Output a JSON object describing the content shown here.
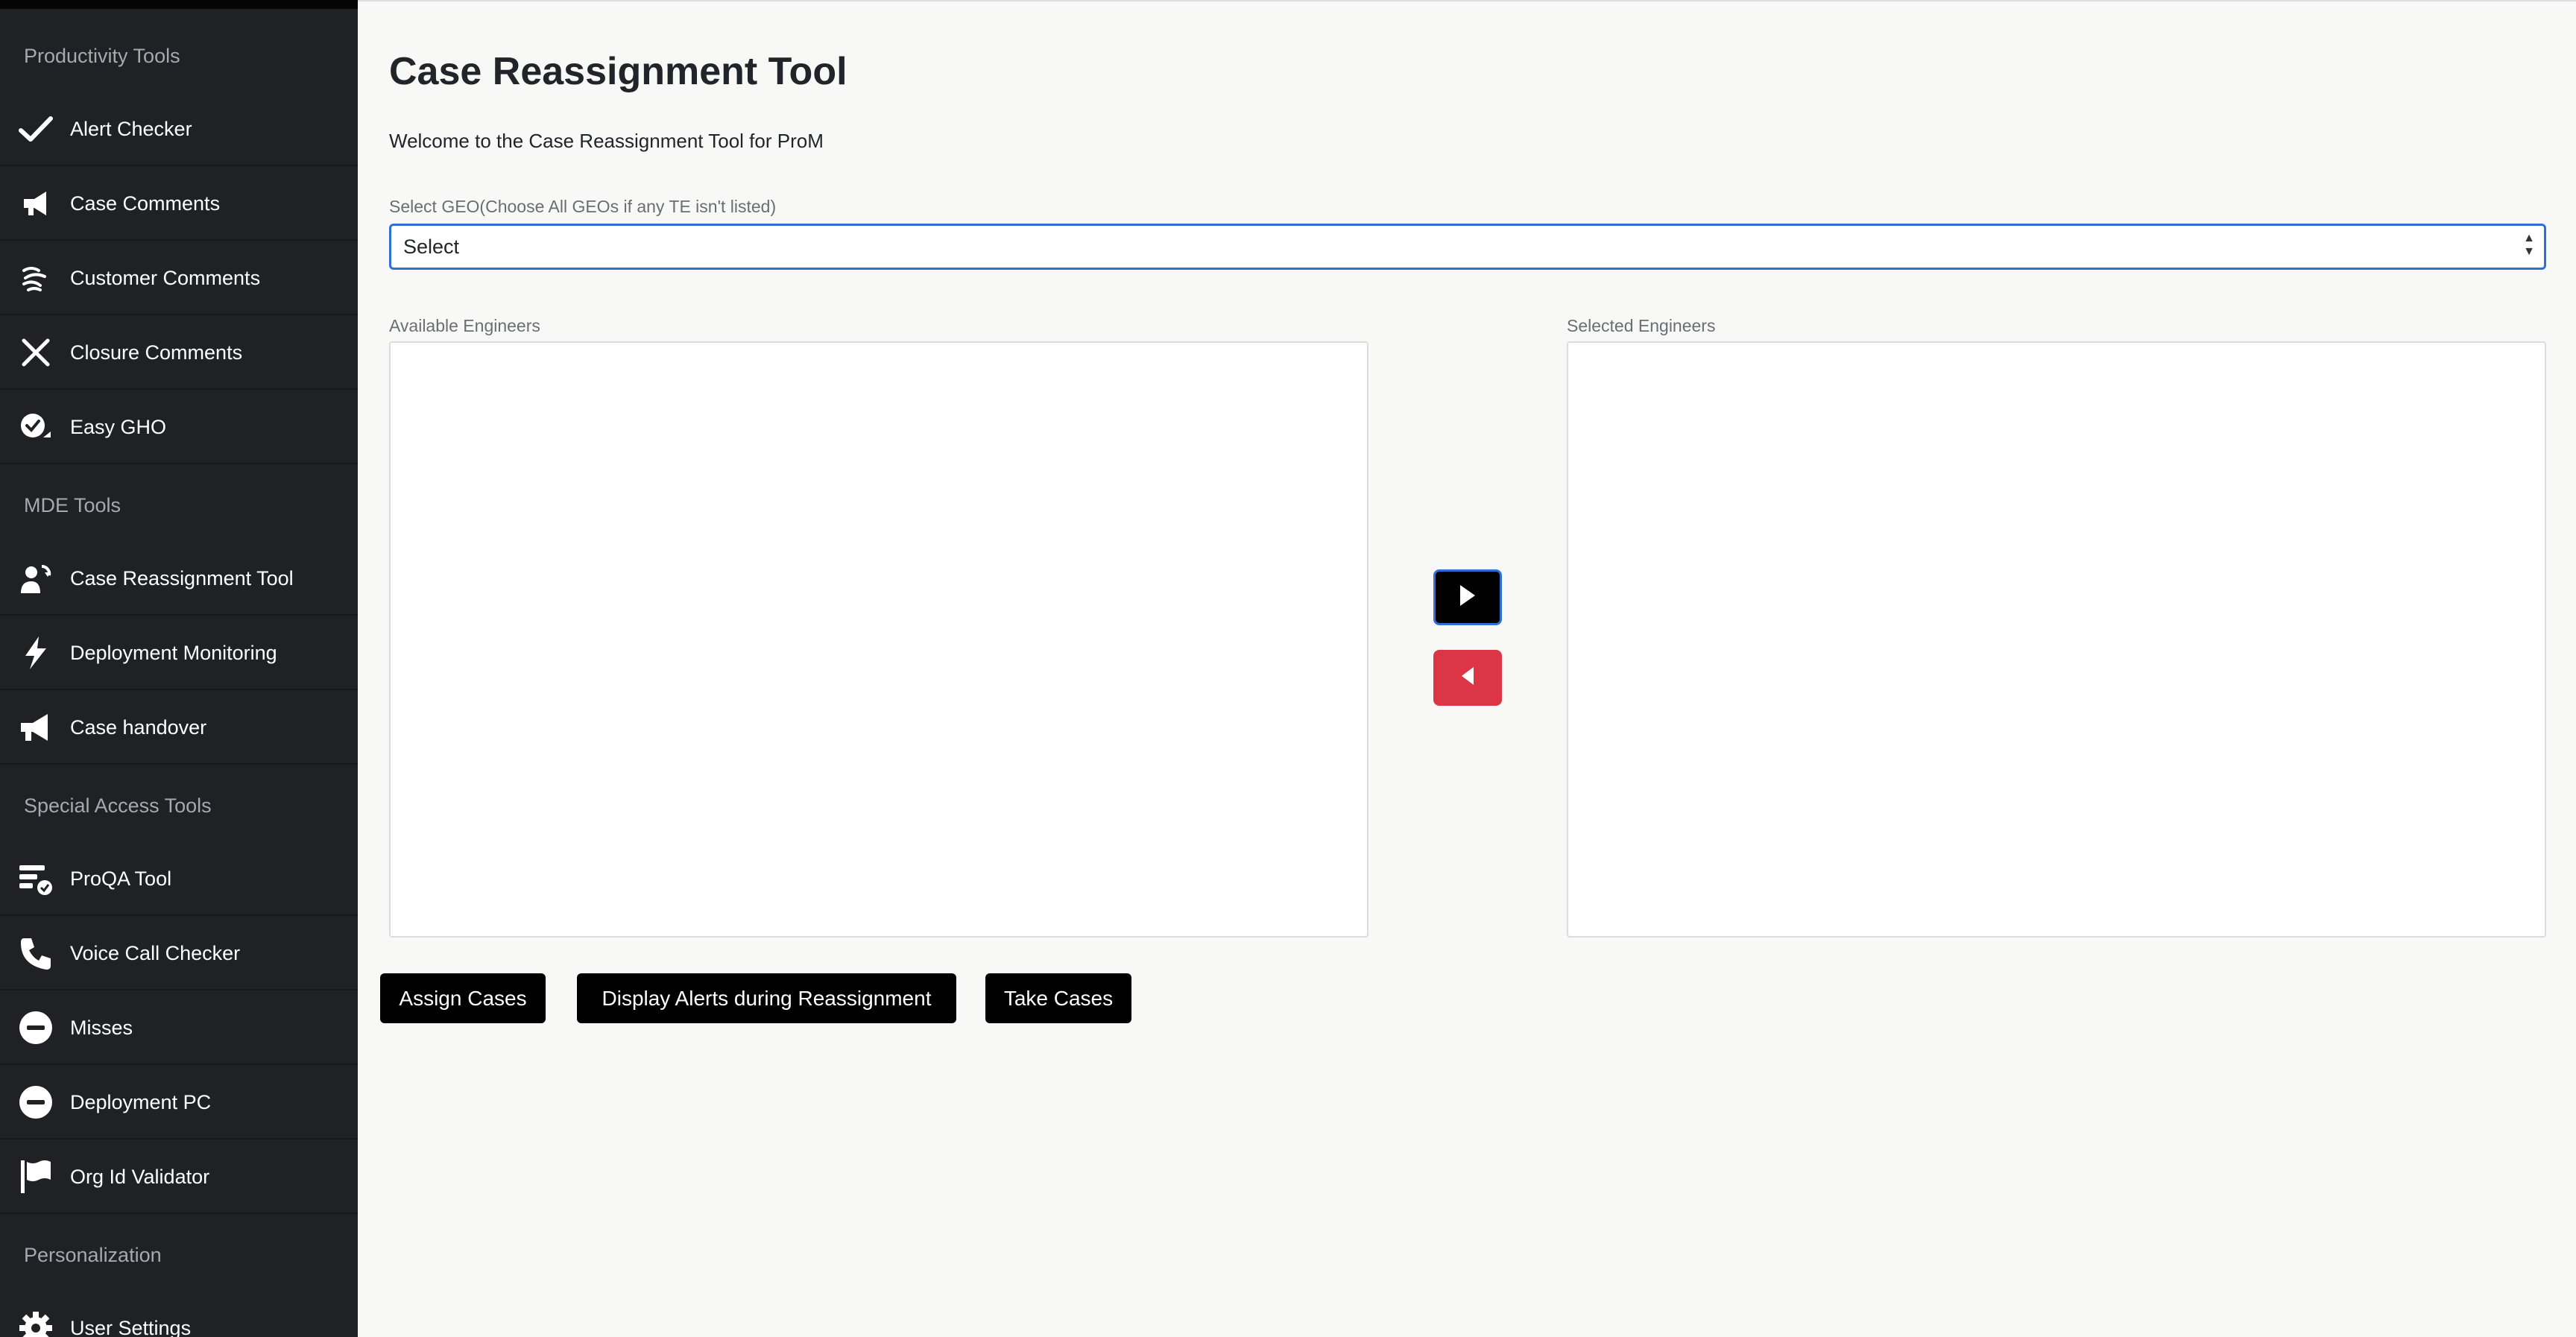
{
  "sidebar": {
    "sections": [
      {
        "title": "Productivity Tools",
        "items": [
          {
            "label": "Alert Checker",
            "icon": "check-icon"
          },
          {
            "label": "Case Comments",
            "icon": "megaphone-icon"
          },
          {
            "label": "Customer Comments",
            "icon": "waves-icon"
          },
          {
            "label": "Closure Comments",
            "icon": "close-icon"
          },
          {
            "label": "Easy GHO",
            "icon": "chat-check-icon"
          }
        ]
      },
      {
        "title": "MDE Tools",
        "items": [
          {
            "label": "Case Reassignment Tool",
            "icon": "user-swap-icon"
          },
          {
            "label": "Deployment Monitoring",
            "icon": "lightning-icon"
          },
          {
            "label": "Case handover",
            "icon": "megaphone-icon"
          }
        ]
      },
      {
        "title": "Special Access Tools",
        "items": [
          {
            "label": "ProQA Tool",
            "icon": "checklist-icon"
          },
          {
            "label": "Voice Call Checker",
            "icon": "phone-icon"
          },
          {
            "label": "Misses",
            "icon": "minus-circle-icon"
          },
          {
            "label": "Deployment PC",
            "icon": "minus-circle-icon"
          },
          {
            "label": "Org Id Validator",
            "icon": "flag-icon"
          }
        ]
      },
      {
        "title": "Personalization",
        "items": [
          {
            "label": "User Settings",
            "icon": "gear-icon"
          }
        ]
      }
    ]
  },
  "main": {
    "title": "Case Reassignment Tool",
    "welcome": "Welcome to the Case Reassignment Tool for ProM",
    "geo_label": "Select GEO(Choose All GEOs if any TE isn't listed)",
    "geo_selected": "Select",
    "available_label": "Available Engineers",
    "selected_label": "Selected Engineers",
    "buttons": {
      "assign": "Assign Cases",
      "display_alerts": "Display Alerts during Reassignment",
      "take": "Take Cases"
    }
  },
  "colors": {
    "sidebar_bg": "#1f2124",
    "accent_blue": "#2f6fd8",
    "danger_red": "#dc3545",
    "button_black": "#000000"
  }
}
